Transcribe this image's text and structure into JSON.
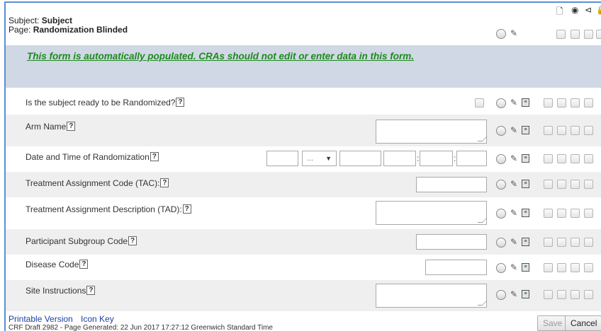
{
  "header": {
    "subject_label": "Subject: ",
    "subject_value": "Subject",
    "page_label": "Page: ",
    "page_value": "Randomization Blinded",
    "column_icons": [
      "document-icon",
      "eye-icon",
      "megaphone-icon",
      "lock-icon"
    ],
    "column_glyphs": [
      "🗋",
      "◉",
      "⊲",
      "🔒"
    ]
  },
  "banner": {
    "message": "This form is automatically populated. CRAs should not edit or enter data in this form."
  },
  "help_glyph": "?",
  "note_glyph": "≡",
  "pencil_glyph": "✎",
  "fields": {
    "ready": "Is the subject ready to be Randomized?",
    "arm": "Arm Name",
    "datetime": "Date and Time of Randomization",
    "tac": "Treatment Assignment Code (TAC):",
    "tad": "Treatment Assignment Description (TAD):",
    "subgroup": "Participant Subgroup Code",
    "disease": "Disease Code",
    "site": "Site Instructions"
  },
  "datetime": {
    "month_placeholder": "...",
    "month_arrow": "▼",
    "sep": ":"
  },
  "footer": {
    "printable": "Printable Version",
    "icon_key": "Icon Key",
    "draft": "CRF Draft 2982 - Page Generated: 22 Jun 2017 17:27:12 Greenwich Standard Time",
    "save": "Save",
    "cancel": "Cancel"
  },
  "colors": {
    "banner_bg": "#cfd8e4",
    "banner_text": "#1e8a1e",
    "row_alt": "#efefef",
    "link": "#1a3fa8"
  }
}
